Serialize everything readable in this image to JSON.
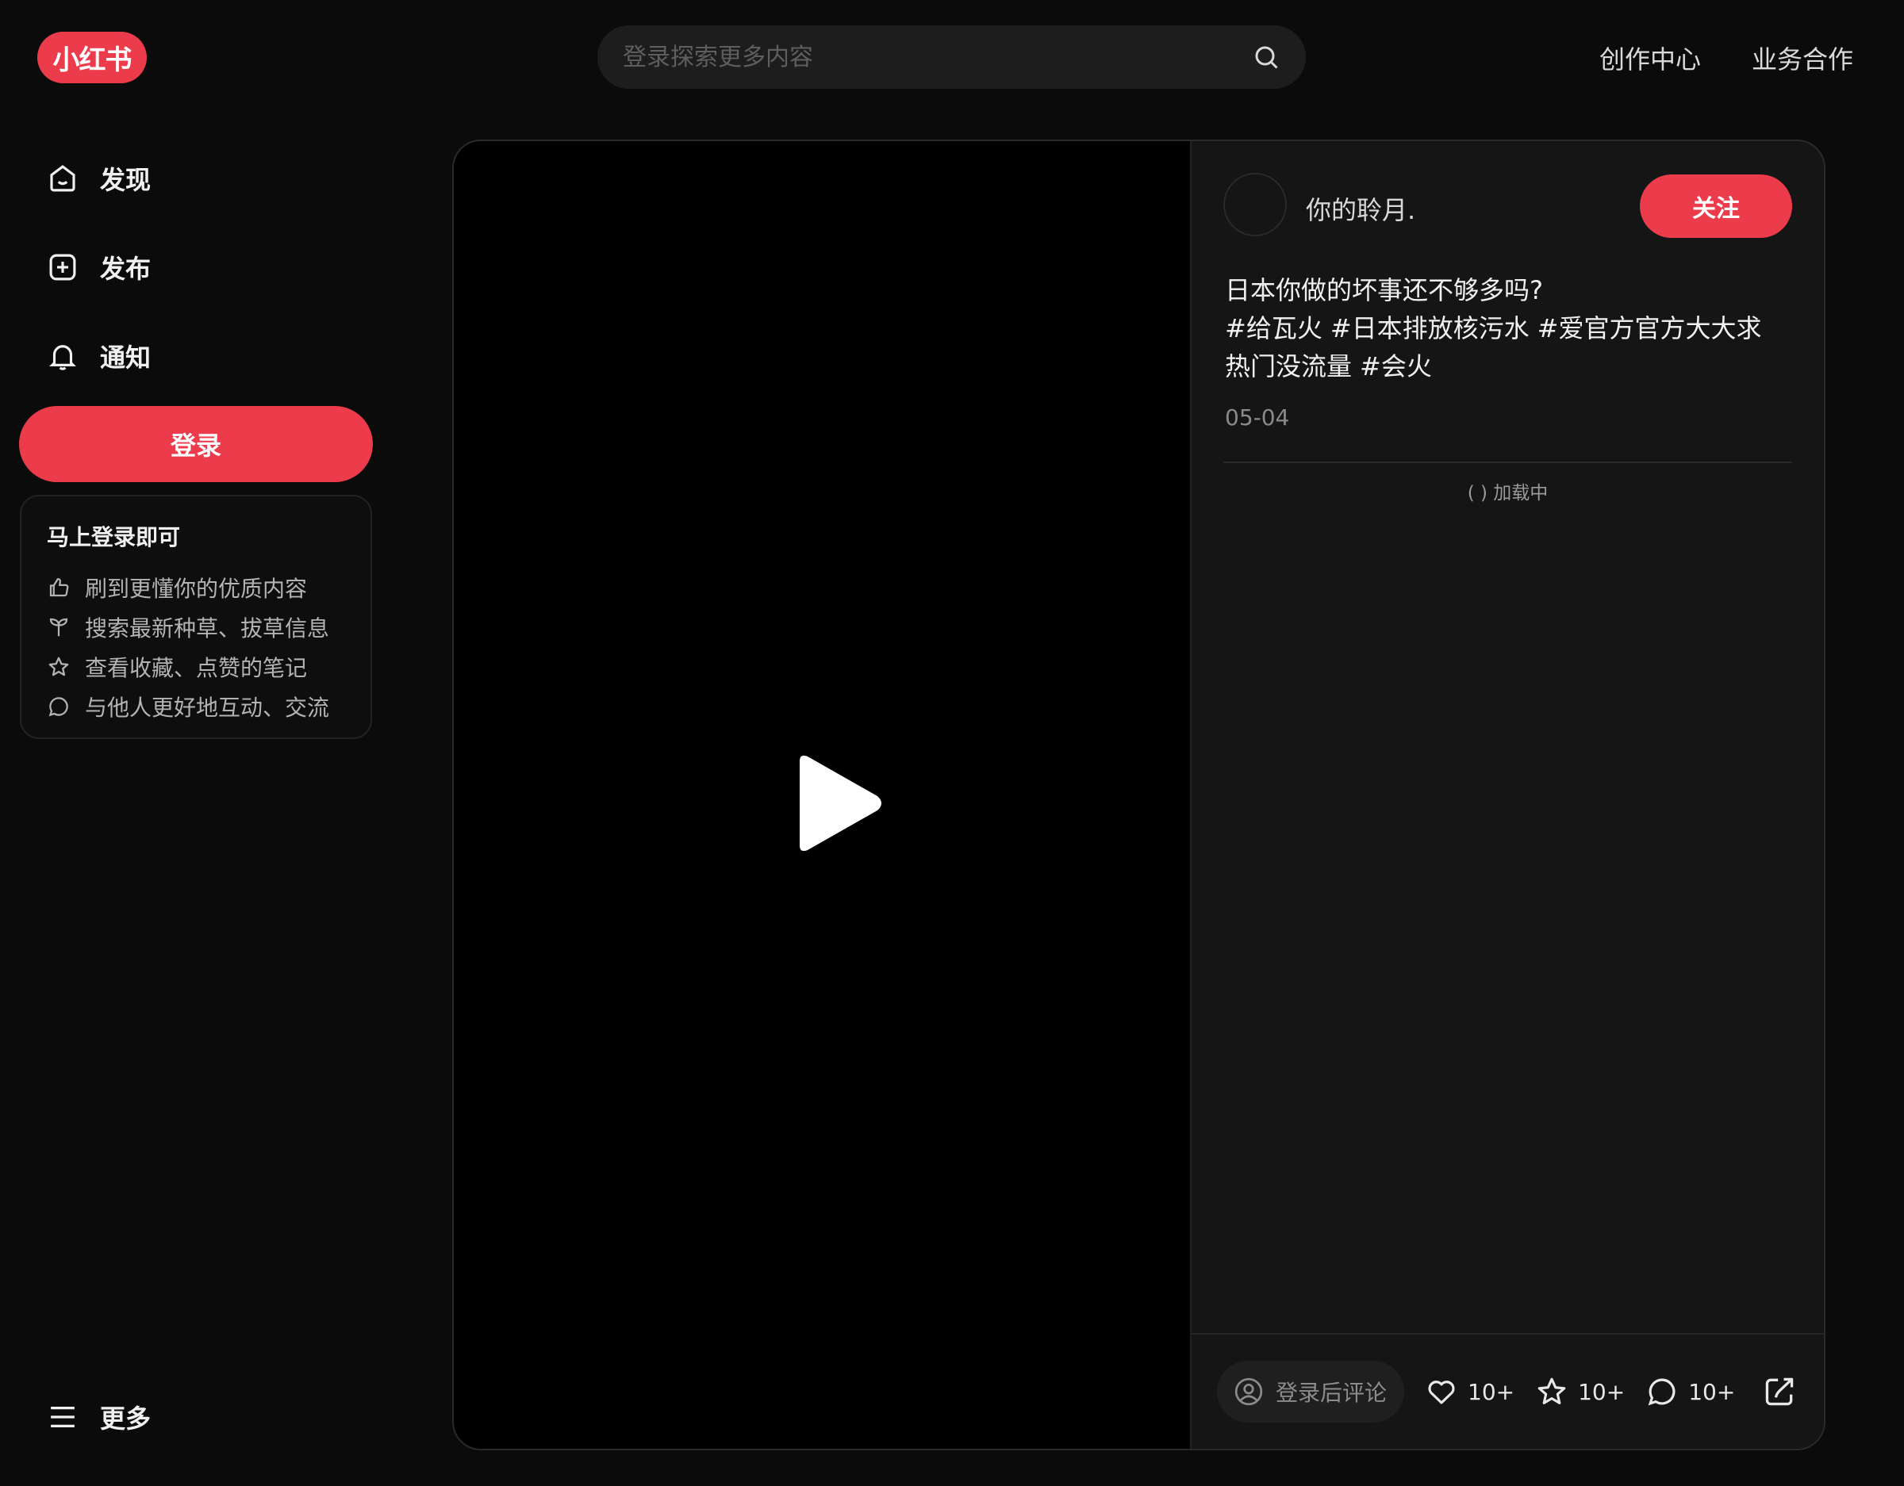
{
  "brand": {
    "logo_text": "小红书",
    "accent": "#ec3c4c"
  },
  "header": {
    "search_placeholder": "登录探索更多内容",
    "links": [
      "创作中心",
      "业务合作"
    ]
  },
  "sidebar": {
    "items": [
      {
        "label": "发现",
        "icon": "home-icon"
      },
      {
        "label": "发布",
        "icon": "plus-square-icon"
      },
      {
        "label": "通知",
        "icon": "bell-icon"
      }
    ],
    "login_label": "登录",
    "promo": {
      "title": "马上登录即可",
      "rows": [
        {
          "text": "刷到更懂你的优质内容",
          "icon": "thumbs-up-icon"
        },
        {
          "text": "搜索最新种草、拔草信息",
          "icon": "sprout-icon"
        },
        {
          "text": "查看收藏、点赞的笔记",
          "icon": "star-icon"
        },
        {
          "text": "与他人更好地互动、交流",
          "icon": "chat-bubble-icon"
        }
      ]
    },
    "more_label": "更多"
  },
  "note": {
    "author": "你的聆月.",
    "follow_label": "关注",
    "title": "日本你做的坏事还不够多吗?",
    "tags": [
      "#给瓦火",
      "#日本排放核污水",
      "#爱官方官方大大求热门没流量",
      "#会火"
    ],
    "date": "05-04",
    "loading_text": "加载中"
  },
  "engagement": {
    "comment_placeholder": "登录后评论",
    "likes": "10+",
    "collects": "10+",
    "comments": "10+"
  }
}
